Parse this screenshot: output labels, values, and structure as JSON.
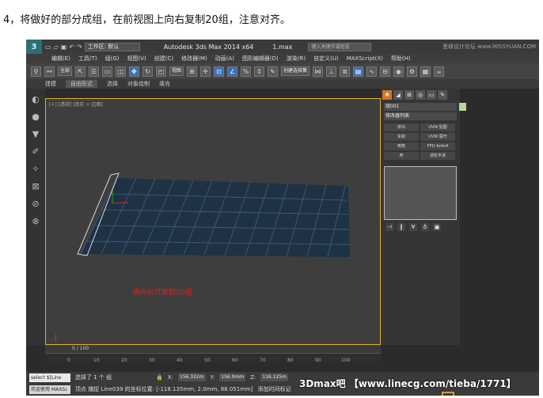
{
  "caption": "4，将做好的部分成组，在前视图上向右复制20组，注意对齐。",
  "titlebar": {
    "workspace_label": "工作区: 默认",
    "app_title": "Autodesk 3ds Max  2014 x64",
    "file_name": "1.max",
    "search_placeholder": "键入关键字或短语",
    "watermark": "思缘设计论坛 www.MISSYUAN.COM"
  },
  "menu": [
    "编辑(E)",
    "工具(T)",
    "组(G)",
    "视图(V)",
    "创建(C)",
    "修改器(M)",
    "动画(A)",
    "图形编辑器(D)",
    "渲染(R)",
    "自定义(U)",
    "MAXScript(X)",
    "帮助(H)"
  ],
  "toolbar": {
    "selection_filter": "全部",
    "view_select": "视图",
    "named_selection": "创建选择集"
  },
  "ribbon": [
    "建模",
    "自由形式",
    "选择",
    "对象绘制",
    "填充"
  ],
  "viewport": {
    "label": "[+] [透视] [真实 + 边面]",
    "annotation": "横向对齐复制20组"
  },
  "command_panel": {
    "object_name": "组001",
    "modifier_list": "修改器列表",
    "buttons": [
      "挤出",
      "UVW 贴图",
      "车削",
      "UVW 展开",
      "倒角",
      "FFD 4x4x4",
      "壳",
      "涡轮平滑"
    ]
  },
  "timeline": {
    "frame": "0 / 100",
    "ticks": [
      "0",
      "10",
      "20",
      "30",
      "40",
      "50",
      "60",
      "70",
      "80",
      "90",
      "100"
    ]
  },
  "status": {
    "listener_text": "select $[Line",
    "selection": "选择了 1 个 组",
    "x_label": "X:",
    "x": "156.332m",
    "y_label": "Y:",
    "y": "156.0mm",
    "z_label": "Z:",
    "z": "116.125m",
    "welcome": "欢迎使用 MAXSc",
    "prompt": "顶点 捕捉 Line039 的坐标位置: [-118.135mm, 2.0mm, 88.051mm]",
    "add_time_tag": "添加时间标记"
  },
  "bottom_watermark": "3Dmax吧 【www.linecg.com/tieba/1771】"
}
